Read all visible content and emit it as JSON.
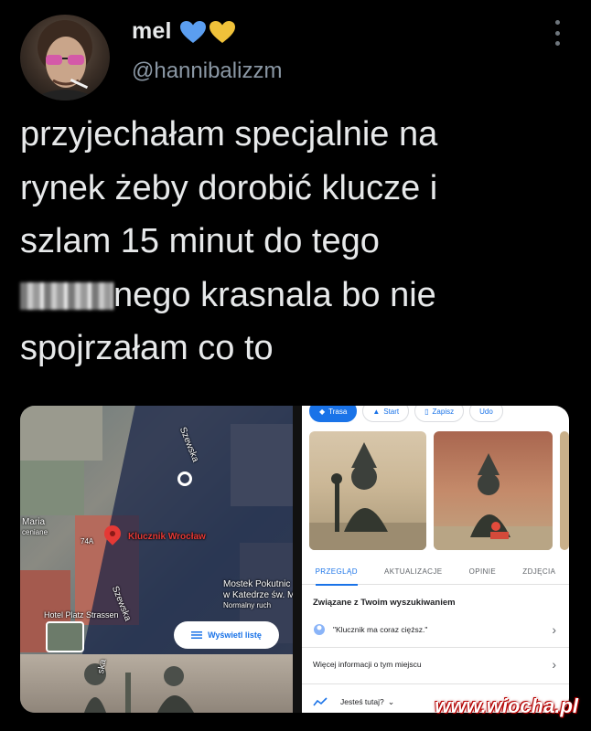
{
  "author": {
    "display_name": "mel",
    "handle": "@hannibalizzm",
    "heart_colors": [
      "#5b9ef0",
      "#f0c23a"
    ]
  },
  "tweet": {
    "lines": [
      "przyjechałam specjalnie na",
      "rynek żeby dorobić klucze i",
      "szlam 15 minut do tego",
      "nego krasnala bo nie",
      "spojrzałam co to"
    ]
  },
  "map": {
    "street_label_1": "Szewska",
    "street_label_2": "Szewska",
    "place_label": "Klucznik Wrocław",
    "left_label_1": "Maria",
    "left_label_2": "ceniane",
    "number_label": "74A",
    "bridge_label_1": "Mostek Pokutnic",
    "bridge_label_2": "w Katedrze św. M",
    "bridge_label_3": "Normalny ruch",
    "hotel_label": "Hotel Platz Strassen",
    "list_button": "Wyświetl listę",
    "ska_label": "ska"
  },
  "details": {
    "action_route": "Trasa",
    "action_start": "Start",
    "action_save": "Zapisz",
    "action_share": "Udo",
    "tabs": [
      "PRZEGLĄD",
      "AKTUALIZACJE",
      "OPINIE",
      "ZDJĘCIA"
    ],
    "related_heading": "Związane z Twoim wyszukiwaniem",
    "review_quote": "\"Klucznik ma coraz cięższ.\"",
    "more_info": "Więcej informacji o tym miejscu",
    "are_you_here": "Jesteś tutaj?"
  },
  "watermark": "www.wiocha.pl",
  "colors": {
    "background": "#000000",
    "text": "#e7e9ea",
    "handle": "#8b98a5",
    "maps_blue": "#1a73e8",
    "pin_red": "#e53935"
  }
}
